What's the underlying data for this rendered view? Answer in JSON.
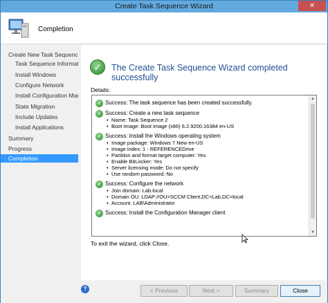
{
  "window": {
    "title": "Create Task Sequence Wizard",
    "close_glyph": "✕"
  },
  "header": {
    "title": "Completion",
    "icon": "computer-icon"
  },
  "sidebar": {
    "items": [
      {
        "label": "Create New Task Sequence",
        "level": 0
      },
      {
        "label": "Task Sequence Informati",
        "level": 1
      },
      {
        "label": "Install Windows",
        "level": 1
      },
      {
        "label": "Configure Network",
        "level": 1
      },
      {
        "label": "Install Configuration Mar",
        "level": 1
      },
      {
        "label": "State Migration",
        "level": 1
      },
      {
        "label": "Include Updates",
        "level": 1
      },
      {
        "label": "Install Applications",
        "level": 1
      },
      {
        "label": "Summary",
        "level": 0
      },
      {
        "label": "Progress",
        "level": 0
      },
      {
        "label": "Completion",
        "level": 0,
        "active": true
      }
    ]
  },
  "main": {
    "headline": "The Create Task Sequence Wizard completed successfully",
    "details_label": "Details:",
    "entries": [
      {
        "title": "Success: The task sequence has been created successfully.",
        "bullets": []
      },
      {
        "title": "Success: Create a new task sequence",
        "bullets": [
          "Name: Task Sequence 2",
          "Boot Image: Boot image (x86) 6.2.9200.16384 en-US"
        ]
      },
      {
        "title": "Success: Install the Windows operating system",
        "bullets": [
          "Image package: Windows 7 New  en-US",
          "Image index: 1 - REFERENCEDrive",
          "Partition and format target computer: Yes",
          "Enable BitLocker: Yes",
          "Server licensing mode: Do not specify",
          "Use random password: No"
        ]
      },
      {
        "title": "Success: Configure the network",
        "bullets": [
          "Join domain: Lab.local",
          "Domain OU: LDAP://OU=SCCM Client,DC=Lab,DC=local",
          "Account: LAB\\Administrator"
        ]
      },
      {
        "title": "Success: Install the Configuration Manager client",
        "bullets": []
      }
    ],
    "exit_text": "To exit the wizard, click Close."
  },
  "footer": {
    "previous_label": "< Previous",
    "next_label": "Next >",
    "summary_label": "Summary",
    "close_label": "Close"
  }
}
